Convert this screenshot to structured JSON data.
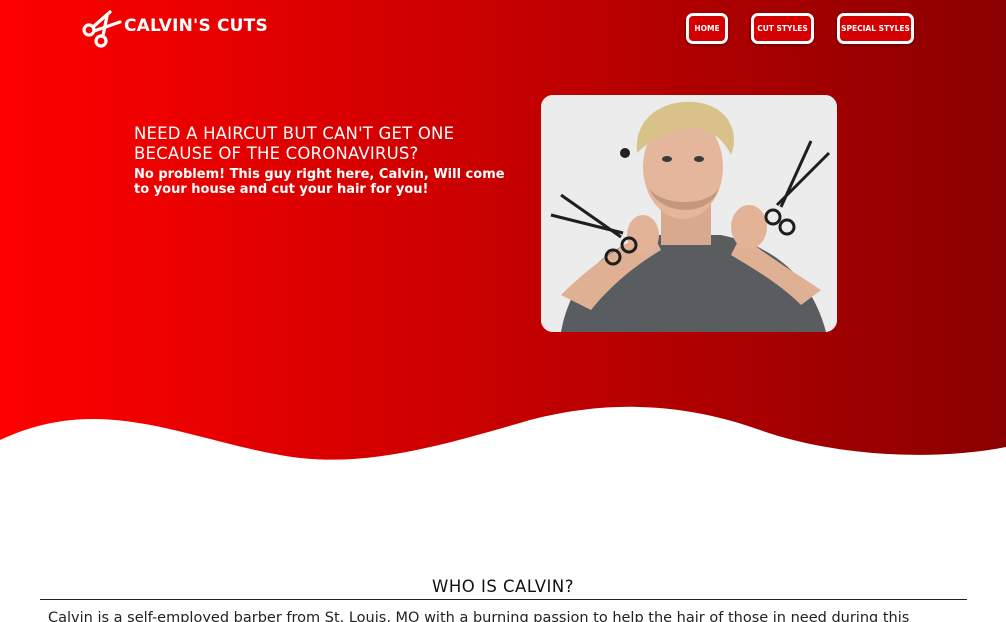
{
  "brand": {
    "name": "CALVIN'S CUTS",
    "icon": "scissors-icon"
  },
  "nav": {
    "items": [
      {
        "label": "HOME"
      },
      {
        "label": "CUT STYLES"
      },
      {
        "label": "SPECIAL STYLES"
      }
    ]
  },
  "hero": {
    "headline": "NEED A HAIRCUT BUT CAN'T GET ONE BECAUSE OF THE CORONAVIRUS?",
    "subline": "No problem! This guy right here, Calvin, Will come to your house and cut your hair for you!",
    "photo_subject": "barber-with-scissors"
  },
  "about": {
    "title": "WHO IS CALVIN?",
    "body": "Calvin is a self-employed barber from St. Louis, MO with a burning passion to help the hair of those in need during this"
  },
  "colors": {
    "hero_gradient_start": "#ff0000",
    "hero_gradient_end": "#8a0000",
    "accent": "#d40000",
    "text_on_red": "#ffffff"
  }
}
